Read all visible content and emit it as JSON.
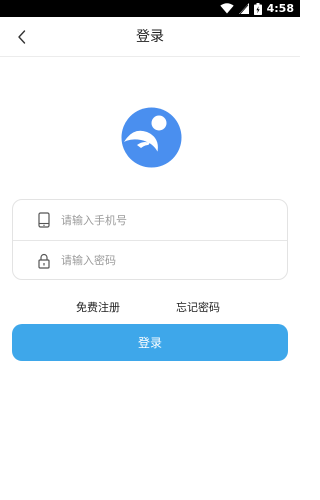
{
  "status_bar": {
    "time": "4:58",
    "icons": [
      "wifi-icon",
      "signal-icon",
      "battery-charging-icon"
    ]
  },
  "nav": {
    "title": "登录",
    "back_icon": "chevron-left-icon"
  },
  "logo": {
    "icon": "app-logo-icon",
    "color": "#4a8fef"
  },
  "form": {
    "phone": {
      "placeholder": "请输入手机号",
      "icon": "phone-icon"
    },
    "password": {
      "placeholder": "请输入密码",
      "icon": "lock-icon"
    }
  },
  "links": {
    "register": "免费注册",
    "forgot_password": "忘记密码"
  },
  "login_button": {
    "label": "登录",
    "color": "#3ea7ea"
  }
}
